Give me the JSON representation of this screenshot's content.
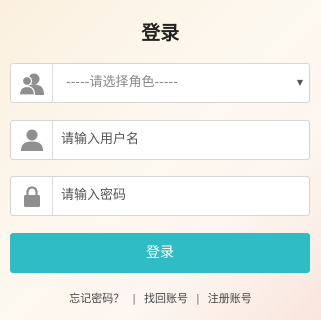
{
  "title": "登录",
  "role_select": {
    "selected": "-----请选择角色-----",
    "icon": "user-group-icon"
  },
  "username": {
    "placeholder": "请输入用户名",
    "icon": "user-icon"
  },
  "password": {
    "placeholder": "请输入密码",
    "icon": "lock-icon"
  },
  "login_button": "登录",
  "links": {
    "forgot_password": "忘记密码？",
    "recover_account": "找回账号",
    "register_account": "注册账号",
    "separator": "|"
  },
  "colors": {
    "accent": "#2fbcc4",
    "icon": "#8f8f8f"
  }
}
